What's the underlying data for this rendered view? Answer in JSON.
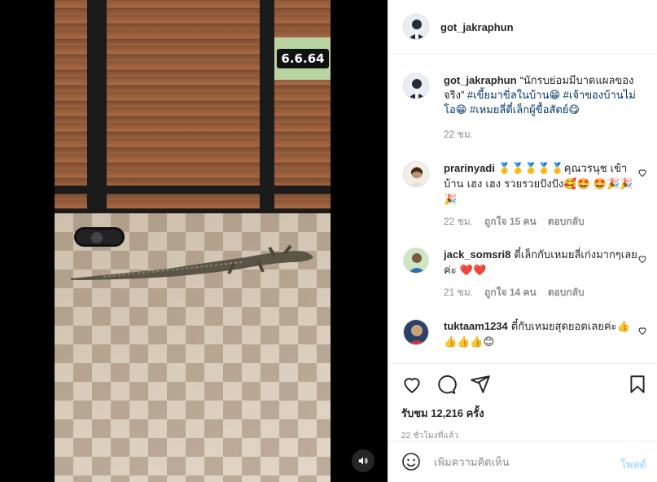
{
  "media": {
    "date_overlay": "6.6.64",
    "sound_icon": "speaker-icon"
  },
  "post": {
    "author": "got_jakraphun",
    "caption": {
      "username": "got_jakraphun",
      "text_1": "“นักรบย่อมมีบาดแผลของจริง” ",
      "tag_1": "#เขี้ยมาขิ่ลในบ้าน😁",
      "text_2": " ",
      "tag_2": "#เจ้าของบ้านไม่โอ😁",
      "text_3": " ",
      "tag_3": "#เหมยลี่ตี๋เล็กผู้ขื้อสัตย์😋",
      "time": "22 ชม."
    },
    "comments": [
      {
        "username": "prarinyadi",
        "text": "🥇🥇🥇🥇🥇คุณวรนุช เข้าบ้าน เฮง เฮง รวยรวยปังปัง🥰🤩 🤩🎉🎉🎉",
        "time": "22 ชม.",
        "likes": "ถูกใจ 15 คน",
        "reply": "ตอบกลับ"
      },
      {
        "username": "jack_somsri8",
        "text": "ตี๋เล็กกับเหมยลี่เก่งมากๆเลยค่ะ ❤️❤️",
        "time": "21 ชม.",
        "likes": "ถูกใจ 14 คน",
        "reply": "ตอบกลับ"
      },
      {
        "username": "tuktaam1234",
        "text": "ตี๋กับเหมยสุดยอดเลยค่ะ👍👍👍👍😊",
        "time": "",
        "likes": "",
        "reply": ""
      }
    ],
    "likes_count": "รับชม 12,216 ครั้ง",
    "time_ago": "22 ชั่วโมงที่แล้ว",
    "comment_placeholder": "เพิ่มความคิดเห็น",
    "post_label": "โพสต์"
  },
  "icons": [
    "heart-icon",
    "comment-icon",
    "share-icon",
    "bookmark-icon",
    "emoji-icon",
    "speaker-icon"
  ],
  "colors": {
    "link": "#00376b",
    "post_button": "#b2dffc",
    "muted": "#8e8e8e"
  }
}
